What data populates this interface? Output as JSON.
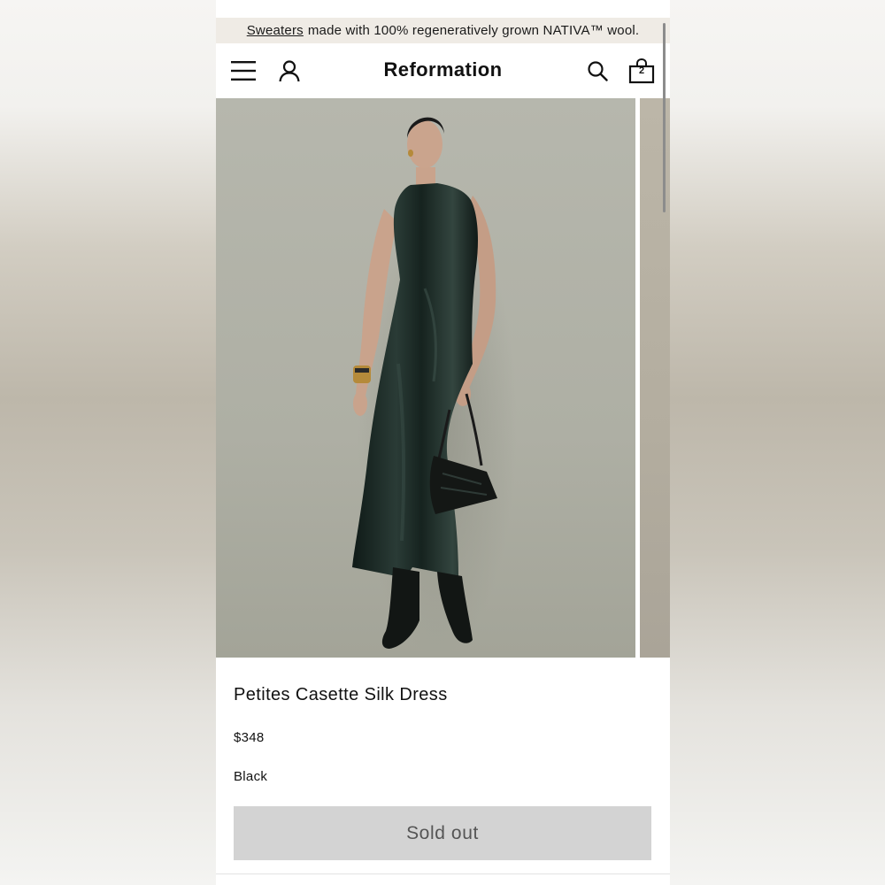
{
  "promo": {
    "link_text": "Sweaters",
    "text": "made with 100% regeneratively grown NATIVA™ wool."
  },
  "header": {
    "brand": "Reformation",
    "cart_count": "2",
    "icons": [
      "menu-icon",
      "account-icon",
      "search-icon",
      "bag-icon"
    ]
  },
  "product": {
    "name": "Petites Casette Silk Dress",
    "price": "$348",
    "color": "Black",
    "button_label": "Sold out"
  },
  "colors": {
    "banner_bg": "#efebe5",
    "photo_backdrop": "#aeb0a5",
    "dress": "#15221e",
    "button_bg": "#d3d3d3",
    "button_text": "#555555"
  }
}
